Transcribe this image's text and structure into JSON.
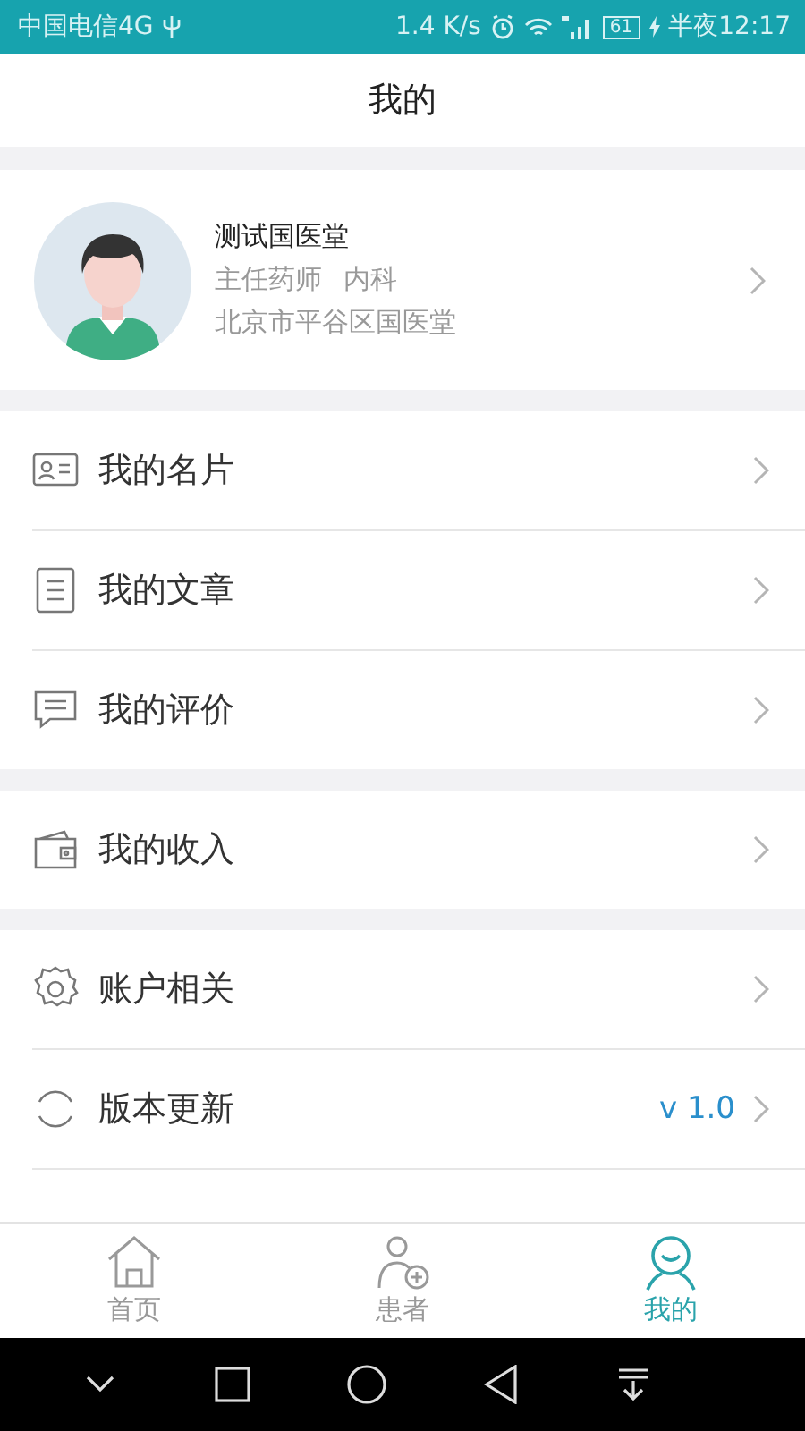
{
  "status_bar": {
    "carrier": "中国电信4G",
    "speed": "1.4 K/s",
    "battery": "61",
    "time": "半夜12:17"
  },
  "header": {
    "title": "我的"
  },
  "profile": {
    "name": "测试国医堂",
    "title": "主任药师",
    "department": "内科",
    "hospital": "北京市平谷区国医堂"
  },
  "sections": [
    {
      "items": [
        {
          "label": "我的名片"
        },
        {
          "label": "我的文章"
        },
        {
          "label": "我的评价"
        }
      ]
    },
    {
      "items": [
        {
          "label": "我的收入"
        }
      ]
    },
    {
      "items": [
        {
          "label": "账户相关"
        },
        {
          "label": "版本更新",
          "value": "v 1.0"
        }
      ]
    }
  ],
  "tabs": [
    {
      "label": "首页",
      "selected": false
    },
    {
      "label": "患者",
      "selected": false
    },
    {
      "label": "我的",
      "selected": true
    }
  ]
}
